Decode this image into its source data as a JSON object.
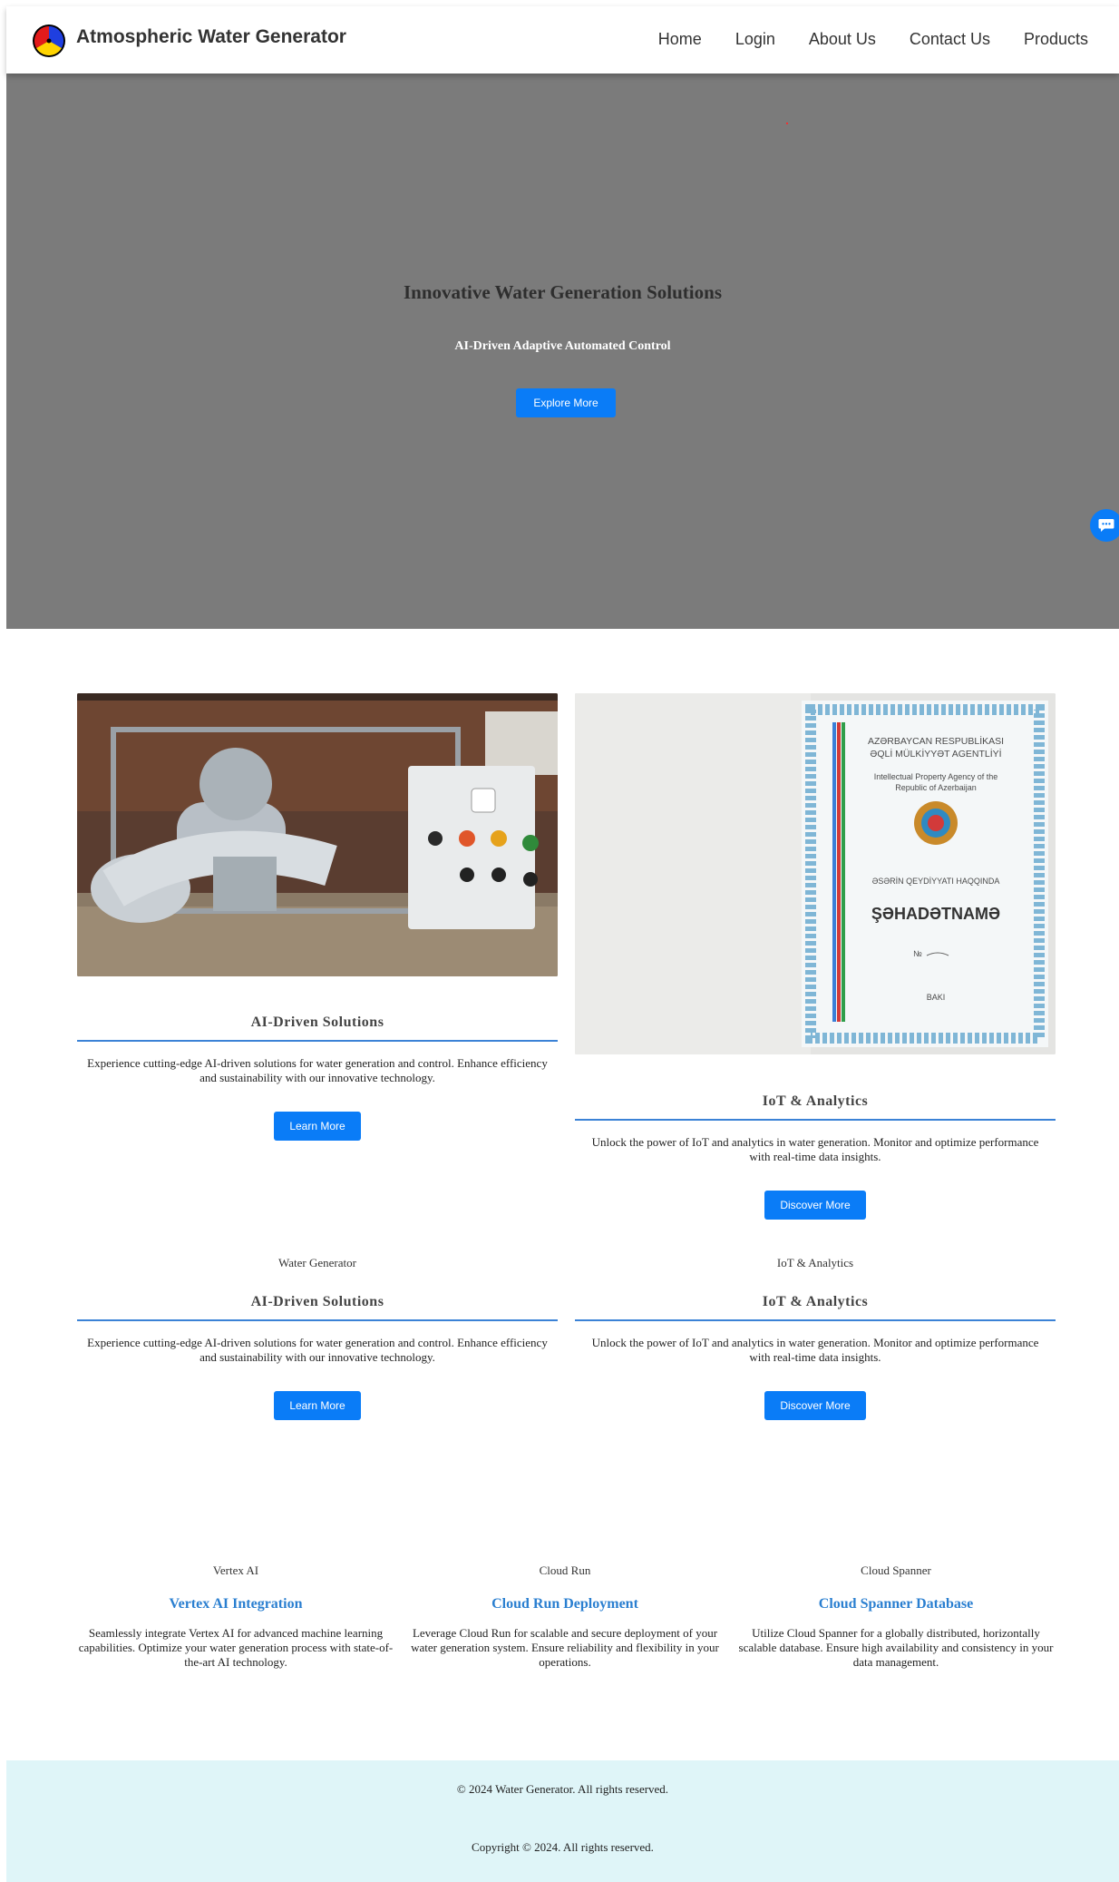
{
  "navbar": {
    "brand": "Atmospheric Water Generator",
    "links": [
      "Home",
      "Login",
      "About Us",
      "Contact Us",
      "Products"
    ]
  },
  "hero": {
    "title": "Innovative Water Generation Solutions",
    "subtitle": "AI-Driven Adaptive Automated Control",
    "button": "Explore More"
  },
  "cards_row1": [
    {
      "title": "AI-Driven Solutions",
      "text": "Experience cutting-edge AI-driven solutions for water generation and control. Enhance efficiency and sustainability with our innovative technology.",
      "button": "Learn More"
    },
    {
      "title": "IoT & Analytics",
      "text": "Unlock the power of IoT and analytics in water generation. Monitor and optimize performance with real-time data insights.",
      "button": "Discover More"
    }
  ],
  "certificate": {
    "line1": "AZƏRBAYCAN RESPUBLİKASI",
    "line2": "ƏQLİ MÜLKİYYƏT AGENTLİYİ",
    "line3": "Intellectual Property Agency of the",
    "line4": "Republic of Azerbaijan",
    "line5": "ƏSƏRİN QEYDİYYATI HAQQINDA",
    "line6": "ŞƏHADƏTNAMƏ",
    "line7": "№",
    "line8": "BAKI"
  },
  "cards_row2": [
    {
      "alt": "Water Generator",
      "title": "AI-Driven Solutions",
      "text": "Experience cutting-edge AI-driven solutions for water generation and control. Enhance efficiency and sustainability with our innovative technology.",
      "button": "Learn More"
    },
    {
      "alt": "IoT & Analytics",
      "title": "IoT & Analytics",
      "text": "Unlock the power of IoT and analytics in water generation. Monitor and optimize performance with real-time data insights.",
      "button": "Discover More"
    }
  ],
  "features": [
    {
      "alt": "Vertex AI",
      "title": "Vertex AI Integration",
      "text": "Seamlessly integrate Vertex AI for advanced machine learning capabilities. Optimize your water generation process with state-of-the-art AI technology."
    },
    {
      "alt": "Cloud Run",
      "title": "Cloud Run Deployment",
      "text": "Leverage Cloud Run for scalable and secure deployment of your water generation system. Ensure reliability and flexibility in your operations."
    },
    {
      "alt": "Cloud Spanner",
      "title": "Cloud Spanner Database",
      "text": "Utilize Cloud Spanner for a globally distributed, horizontally scalable database. Ensure high availability and consistency in your data management."
    }
  ],
  "footer": {
    "line1": "© 2024 Water Generator. All rights reserved.",
    "line2": "Copyright © 2024. All rights reserved."
  }
}
